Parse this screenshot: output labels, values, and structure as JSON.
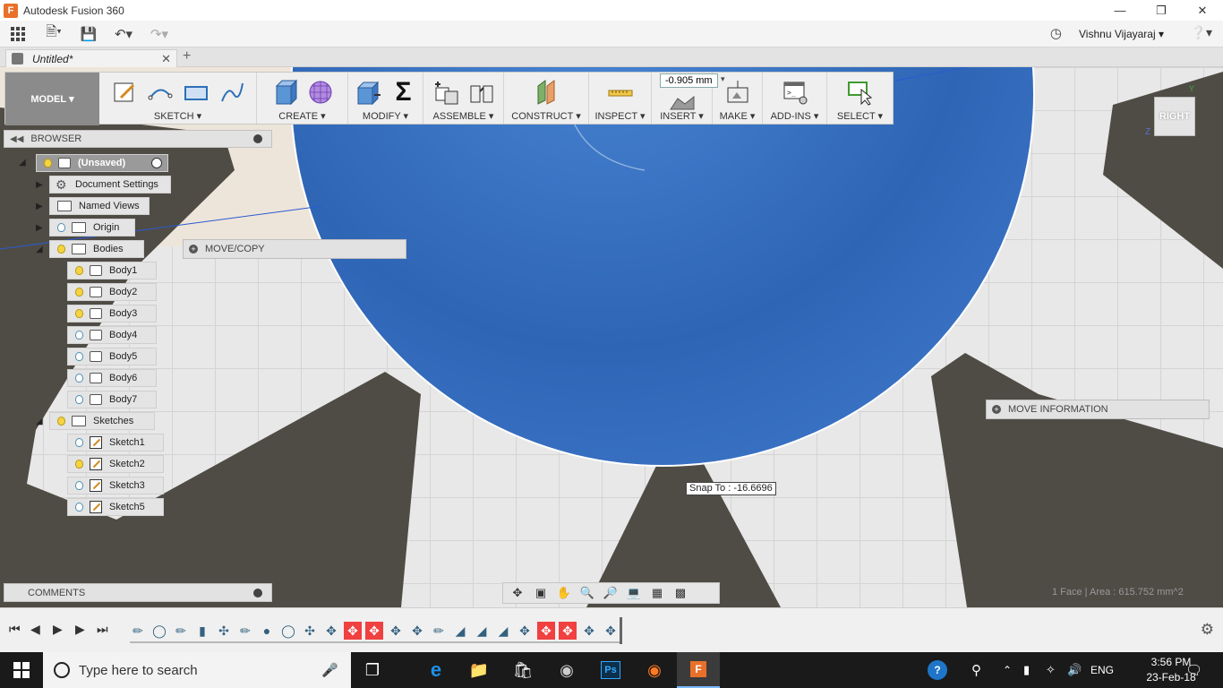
{
  "window": {
    "title": "Autodesk Fusion 360",
    "app_icon": "F"
  },
  "qat": {
    "user_name": "Vishnu Vijayaraj"
  },
  "tab": {
    "name": "Untitled*"
  },
  "toolbar": {
    "workspace": "MODEL",
    "groups": [
      "SKETCH",
      "CREATE",
      "MODIFY",
      "ASSEMBLE",
      "CONSTRUCT",
      "INSPECT",
      "INSERT",
      "MAKE",
      "ADD-INS",
      "SELECT"
    ],
    "dimension_value": "-0.905 mm"
  },
  "viewcube": {
    "label": "RIGHT",
    "axis_z": "Z",
    "axis_y": "Y"
  },
  "browser": {
    "title": "BROWSER",
    "root": "(Unsaved)",
    "items": {
      "document_settings": "Document Settings",
      "named_views": "Named Views",
      "origin": "Origin",
      "bodies": "Bodies",
      "sketches": "Sketches"
    },
    "bodies": [
      "Body1",
      "Body2",
      "Body3",
      "Body4",
      "Body5",
      "Body6",
      "Body7"
    ],
    "sketches": [
      "Sketch1",
      "Sketch2",
      "Sketch3",
      "Sketch5"
    ]
  },
  "panels": {
    "move_copy": "MOVE/COPY",
    "move_information": "MOVE INFORMATION"
  },
  "snap_tooltip": "Snap To : -16.6696",
  "status": "1 Face | Area : 615.752 mm^2",
  "comments": {
    "title": "COMMENTS"
  },
  "taskbar": {
    "search_placeholder": "Type here to search",
    "language": "ENG",
    "time": "3:56 PM",
    "date": "23-Feb-18"
  },
  "colors": {
    "sphere": "#3f78c6",
    "gear_tooth": "#4f4c45",
    "move_feature": "#f04040"
  }
}
